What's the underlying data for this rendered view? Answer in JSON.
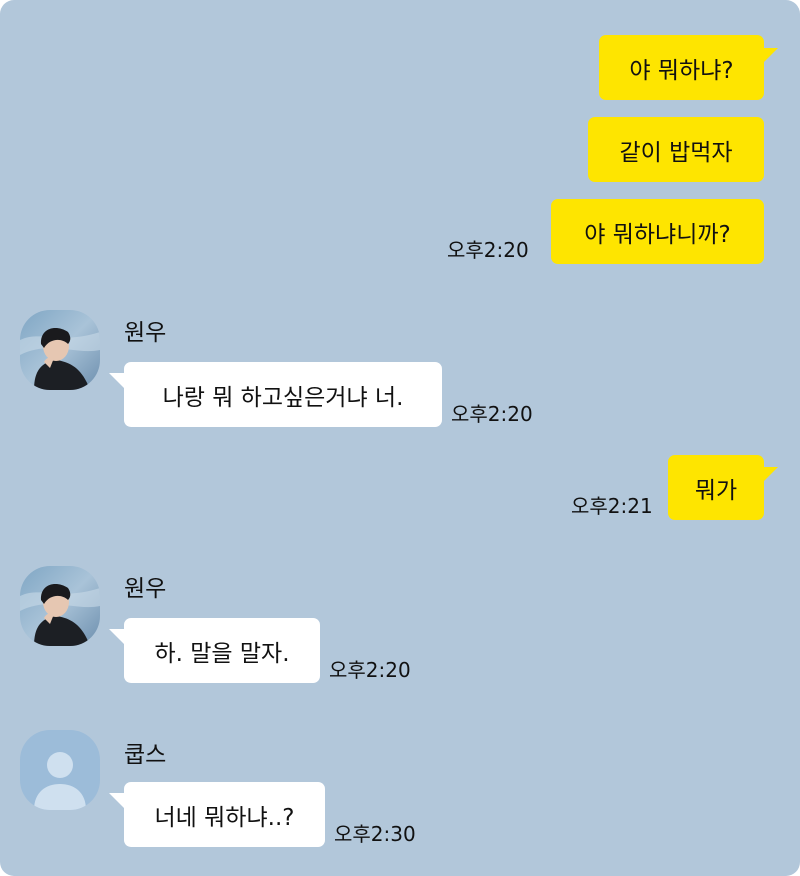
{
  "chat": {
    "background_color": "#b2c7da",
    "my_bubble_color": "#fee500",
    "their_bubble_color": "#ffffff",
    "messages": [
      {
        "sender": "me",
        "text": "야 뭐하냐?"
      },
      {
        "sender": "me",
        "text": "같이 밥먹자"
      },
      {
        "sender": "me",
        "text": "야 뭐하냐니까?",
        "time": "오후2:20"
      },
      {
        "sender": "원우",
        "avatar": "profile-photo",
        "text": "나랑 뭐 하고싶은거냐 너.",
        "time": "오후2:20"
      },
      {
        "sender": "me",
        "text": "뭐가",
        "time": "오후2:21"
      },
      {
        "sender": "원우",
        "avatar": "profile-photo",
        "text": "하. 말을 말자.",
        "time": "오후2:20"
      },
      {
        "sender": "쿱스",
        "avatar": "default-person-icon",
        "text": "너네 뭐하냐..?",
        "time": "오후2:30"
      }
    ]
  }
}
